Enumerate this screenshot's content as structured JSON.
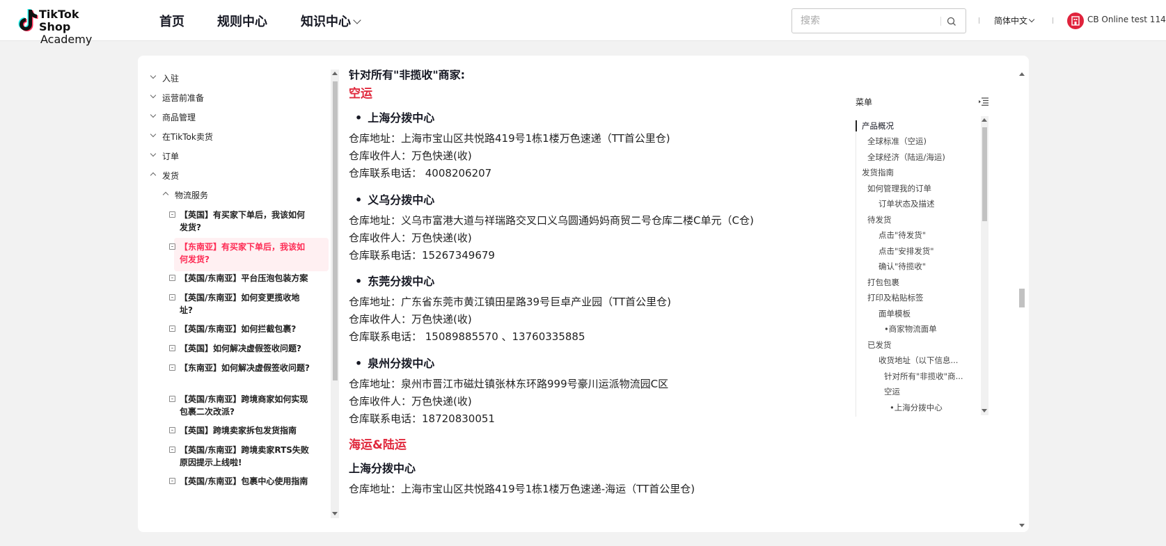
{
  "header": {
    "logo_line1": "TikTok Shop",
    "logo_line2": "Academy",
    "nav": [
      "首页",
      "规则中心",
      "知识中心"
    ],
    "search_placeholder": "搜索",
    "language": "简体中文",
    "user_name": "CB Online test 114",
    "brand_color": "#fe2c55"
  },
  "sidebar": {
    "top_items": [
      "入驻",
      "运营前准备",
      "商品管理",
      "在TikTok卖货",
      "订单",
      "发货"
    ],
    "sub_item": "物流服务",
    "leaves": [
      "【英国】有买家下单后，我该如何发货?",
      "【东南亚】有买家下单后，我该如何发货?",
      "【英国/东南亚】平台压泡包装方案",
      "【英国/东南亚】如何变更揽收地址?",
      "【英国/东南亚】如何拦截包裹?",
      "【英国】如何解决虚假签收问题?",
      "【东南亚】如何解决虚假签收问题?",
      "【英国/东南亚】跨境商家如何实现包裹二次改派?",
      "【英国】跨境卖家拆包发货指南",
      "【英国/东南亚】跨境卖家RTS失败原因提示上线啦!",
      "【英国/东南亚】包裹中心使用指南"
    ],
    "active_leaf_index": 1
  },
  "content": {
    "cut_heading": "针对所有\"非揽收\"商家:",
    "section1_title": "空运",
    "centers": [
      {
        "name": "上海分拨中心",
        "address": "仓库地址：上海市宝山区共悦路419号1栋1楼万色速递（TT首公里仓)",
        "receiver": "仓库收件人：万色快递(收)",
        "phone": "仓库联系电话： 4008206207"
      },
      {
        "name": "义乌分拨中心",
        "address": "仓库地址：义乌市富港大道与祥瑞路交叉口义乌圆通妈妈商贸二号仓库二楼C单元（C仓)",
        "receiver": "仓库收件人：万色快递(收)",
        "phone": "仓库联系电话：15267349679"
      },
      {
        "name": "东莞分拨中心",
        "address": "仓库地址：广东省东莞市黄江镇田星路39号巨卓产业园（TT首公里仓)",
        "receiver": "仓库收件人：万色快递(收)",
        "phone": "仓库联系电话： 15089885570 、13760335885"
      },
      {
        "name": "泉州分拨中心",
        "address": "仓库地址：泉州市晋江市磁灶镇张林东环路999号豪川运派物流园C区",
        "receiver": "仓库收件人：万色快递(收)",
        "phone": "仓库联系电话：18720830051"
      }
    ],
    "section2_title": "海运&陆运",
    "section2_center": "上海分拨中心",
    "section2_address": "仓库地址：上海市宝山区共悦路419号1栋1楼万色速递-海运（TT首公里仓)"
  },
  "toc": {
    "title": "菜单",
    "items": [
      "产品概况",
      "全球标准（空运)",
      "全球经济（陆运/海运)",
      "发货指南",
      "如何管理我的订单",
      "订单状态及描述",
      "待发货",
      "点击\"待发货\"",
      "点击\"安排发货\"",
      "确认\"待揽收\"",
      "打包包裹",
      "打印及粘贴标签",
      "面单模板",
      "•商家物流面单",
      "已发货",
      "收货地址（以下信息...",
      "针对所有\"非揽收\"商...",
      "空运",
      "•上海分拨中心"
    ]
  }
}
